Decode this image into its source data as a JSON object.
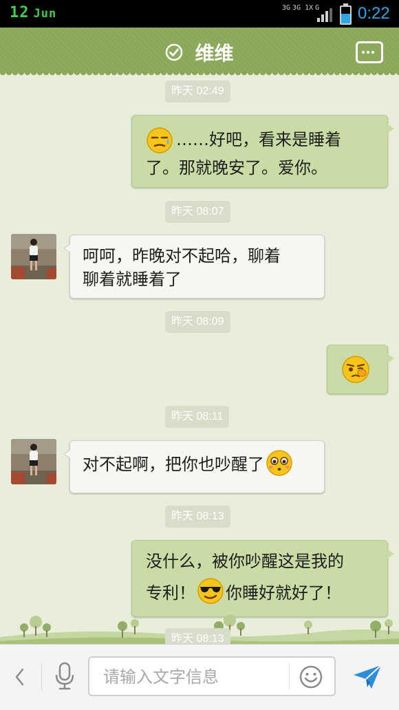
{
  "status_bar": {
    "day": "12",
    "month": "Jun",
    "network": [
      "3G",
      "3G 1X",
      "G"
    ],
    "time": "0:22"
  },
  "header": {
    "title": "维维",
    "verified_icon": "check-circle-icon",
    "menu_icon": "more-dots-icon"
  },
  "messages": [
    {
      "type": "time",
      "text": "昨天 02:49"
    },
    {
      "type": "outgoing",
      "emoji": "sweat-face",
      "line1": "……好吧，看来是睡着",
      "line2": "了。那就晚安了。爱你。"
    },
    {
      "type": "time",
      "text": "昨天 08:07"
    },
    {
      "type": "incoming",
      "line1": "呵呵，昨晚对不起哈，聊着",
      "line2": "聊着就睡着了"
    },
    {
      "type": "time",
      "text": "昨天 08:09"
    },
    {
      "type": "outgoing",
      "emoji": "eye-rub-face"
    },
    {
      "type": "time",
      "text": "昨天 08:11"
    },
    {
      "type": "incoming",
      "line1": "对不起啊，把你也吵醒了",
      "emoji": "teary-face"
    },
    {
      "type": "time",
      "text": "昨天 08:13"
    },
    {
      "type": "outgoing",
      "line1": "没什么，被你吵醒这是我的",
      "line2a": "专利！",
      "emoji": "sunglasses-face",
      "line2b": "你睡好就好了！"
    },
    {
      "type": "time",
      "text": "昨天 08:13"
    }
  ],
  "input_bar": {
    "placeholder": "请输入文字信息",
    "back_icon": "chevron-left-icon",
    "mic_icon": "microphone-icon",
    "emoji_icon": "smiley-icon",
    "send_icon": "paper-plane-icon"
  },
  "colors": {
    "title_bar": "#8aa85a",
    "background": "#e9eedb",
    "outgoing_bubble": "#c9dca5",
    "incoming_bubble": "#f6f7f3",
    "send": "#2f8fd6"
  }
}
